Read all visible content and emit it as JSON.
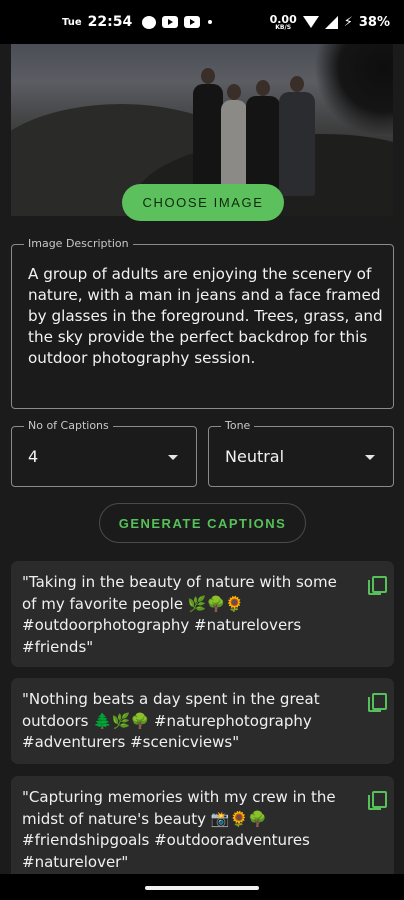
{
  "status_bar": {
    "day": "Tue",
    "time": "22:54",
    "net_speed_value": "0.00",
    "net_speed_unit": "KB/S",
    "battery": "38%"
  },
  "buttons": {
    "choose_image": "CHOOSE IMAGE",
    "generate_captions": "GENERATE CAPTIONS"
  },
  "description": {
    "label": "Image Description",
    "value": "A group of adults are enjoying the scenery of nature, with a man in jeans and a face framed by glasses in the foreground. Trees, grass, and the sky provide the perfect backdrop for this outdoor photography session."
  },
  "captions_count": {
    "label": "No of Captions",
    "value": "4"
  },
  "tone": {
    "label": "Tone",
    "value": "Neutral"
  },
  "captions": [
    {
      "text": "\"Taking in the beauty of nature with some of my favorite people 🌿🌳🌻 #outdoorphotography #naturelovers #friends\""
    },
    {
      "text": "\"Nothing beats a day spent in the great outdoors 🌲🌿🌳 #naturephotography #adventurers #scenicviews\""
    },
    {
      "text": "\"Capturing memories with my crew in the midst of nature's beauty 📸🌻🌳 #friendshipgoals #outdooradventures #naturelover\""
    }
  ],
  "colors": {
    "background": "#1b1b1b",
    "accent_green": "#5cc15c",
    "card": "#2b2b2b"
  },
  "icons": {
    "copy": "copy-icon",
    "dropdown": "caret-down-icon"
  }
}
